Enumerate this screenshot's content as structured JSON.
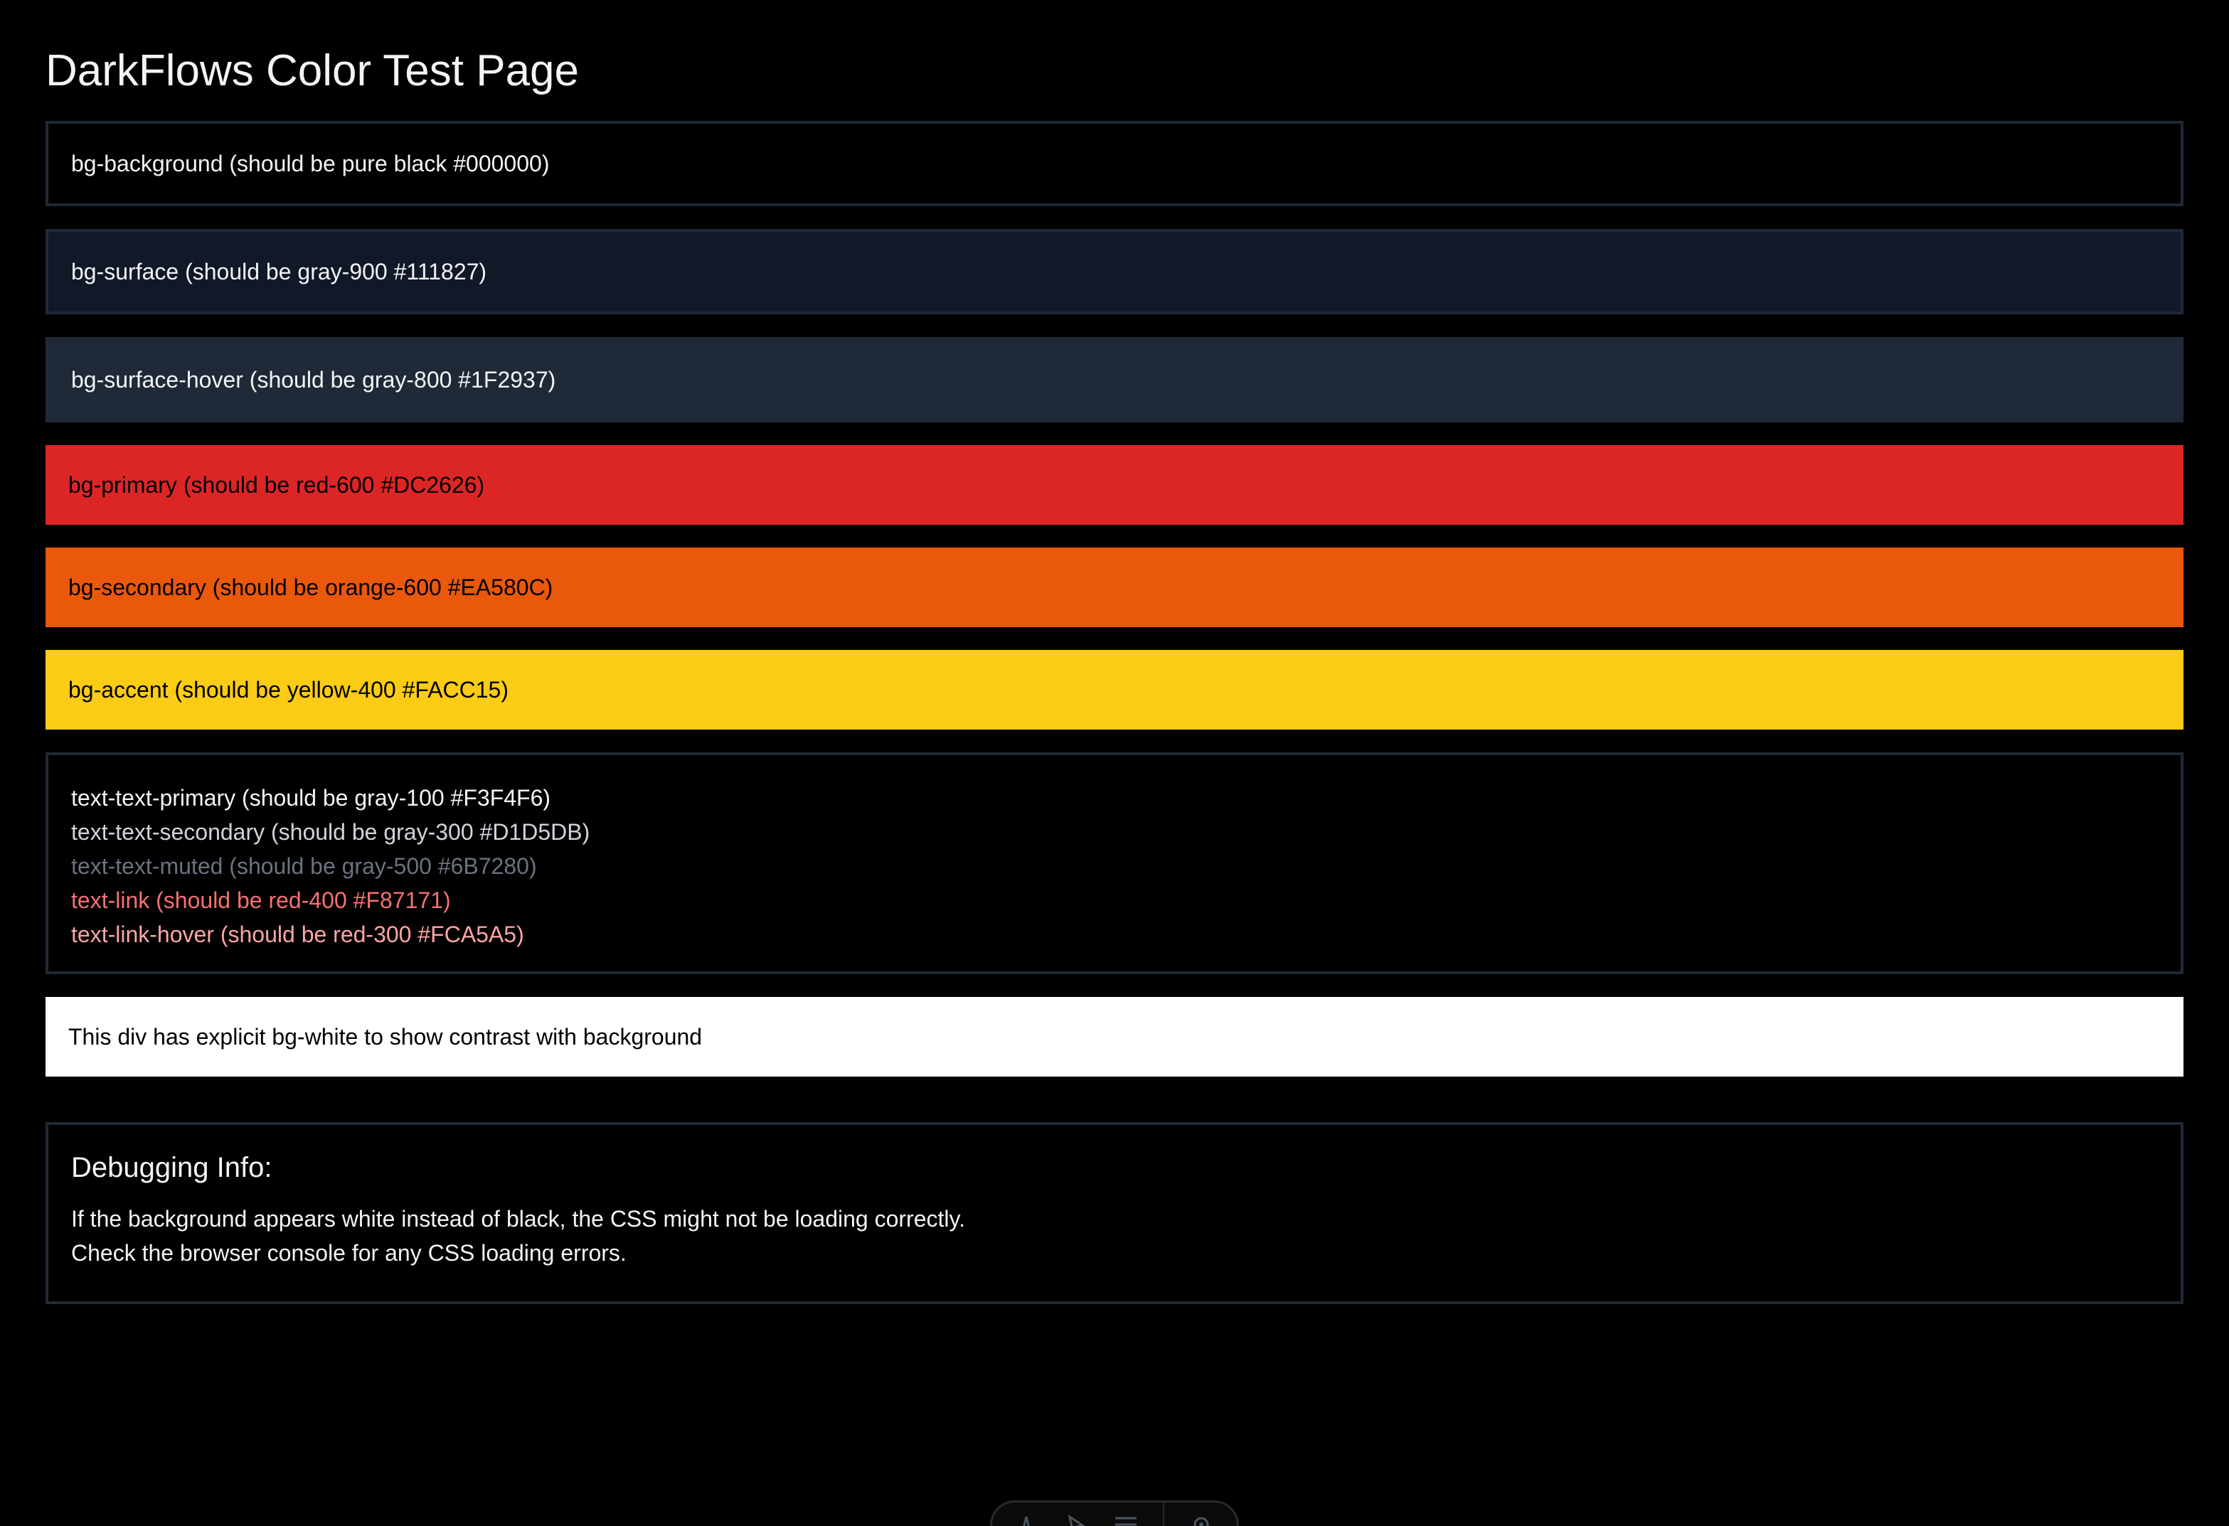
{
  "page": {
    "title": "DarkFlows Color Test Page"
  },
  "swatches": {
    "background": "bg-background (should be pure black #000000)",
    "surface": "bg-surface (should be gray-900 #111827)",
    "surface_hover": "bg-surface-hover (should be gray-800 #1F2937)",
    "primary": "bg-primary (should be red-600 #DC2626)",
    "secondary": "bg-secondary (should be orange-600 #EA580C)",
    "accent": "bg-accent (should be yellow-400 #FACC15)"
  },
  "text_samples": {
    "primary": "text-text-primary (should be gray-100 #F3F4F6)",
    "secondary": "text-text-secondary (should be gray-300 #D1D5DB)",
    "muted": "text-text-muted (should be gray-500 #6B7280)",
    "link": "text-link (should be red-400 #F87171)",
    "link_hover": "text-link-hover (should be red-300 #FCA5A5)"
  },
  "white_box": {
    "text": "This div has explicit bg-white to show contrast with background"
  },
  "debug": {
    "heading": "Debugging Info:",
    "line1": "If the background appears white instead of black, the CSS might not be loading correctly.",
    "line2": "Check the browser console for any CSS loading errors."
  },
  "colors": {
    "background": "#000000",
    "surface": "#111827",
    "surface_hover": "#1F2937",
    "primary": "#DC2626",
    "secondary": "#EA580C",
    "accent": "#FACC15",
    "text_primary": "#F3F4F6",
    "text_secondary": "#D1D5DB",
    "text_muted": "#6B7280",
    "link": "#F87171",
    "link_hover": "#FCA5A5"
  },
  "dev_toolbar": {
    "icons": [
      "astro-icon",
      "cursor-icon",
      "menu-icon",
      "settings-icon"
    ]
  }
}
